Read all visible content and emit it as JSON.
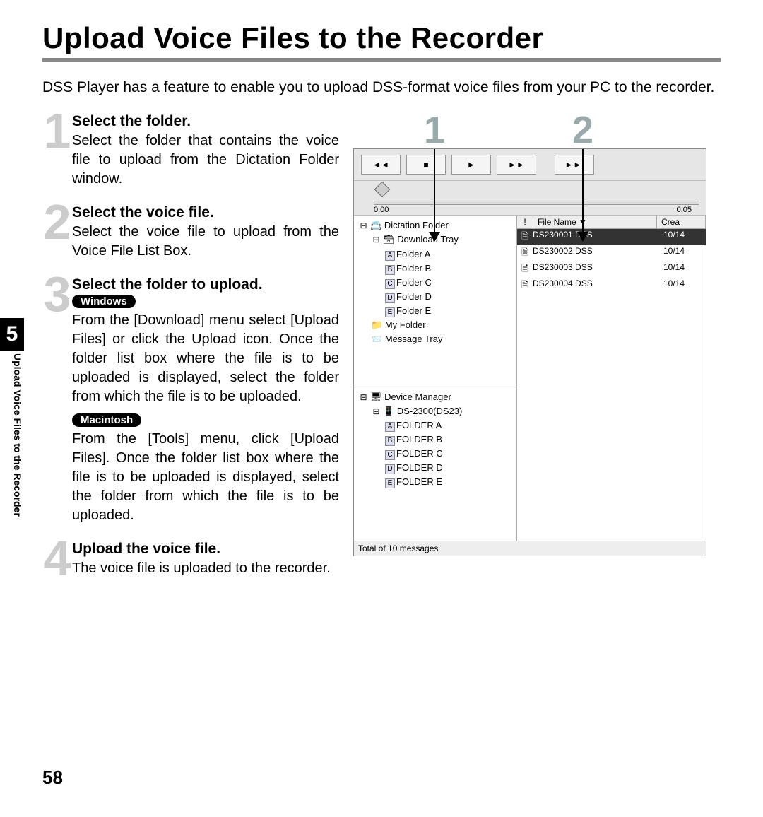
{
  "page": {
    "title": "Upload Voice Files to the Recorder",
    "intro": "DSS Player has a feature to enable you to upload DSS-format voice files from your PC to the recorder.",
    "chapter_number": "5",
    "chapter_title_vert": "Upload Voice Files to the Recorder",
    "page_number": "58"
  },
  "steps": [
    {
      "num": "1",
      "title": "Select the folder.",
      "body": "Select the folder that contains the voice file to upload from the Dictation Folder window."
    },
    {
      "num": "2",
      "title": "Select the voice file.",
      "body": "Select the voice file to upload from the Voice File List Box."
    },
    {
      "num": "3",
      "title": "Select the folder to upload.",
      "pill_win": "Windows",
      "body_win": "From the [Download] menu select [Upload Files] or click the Upload icon. Once the folder list box where the file is to be uploaded is displayed, select the folder from which the file is to be uploaded.",
      "pill_mac": "Macintosh",
      "body_mac": "From the [Tools] menu, click [Upload Files]. Once the folder list box where the file is to be uploaded is displayed, select the folder from which the file is to be uploaded."
    },
    {
      "num": "4",
      "title": "Upload the voice file.",
      "body": "The voice file is uploaded to the recorder."
    }
  ],
  "callouts": {
    "c1": "1",
    "c2": "2"
  },
  "app": {
    "toolbar": {
      "rew": "◄◄",
      "stop": "■",
      "play": "►",
      "ff": "►►",
      "next": "►►I"
    },
    "slider": {
      "tick_left": "0.00",
      "tick_right": "0.05"
    },
    "tree_upper": {
      "root": "Dictation Folder",
      "download": "Download Tray",
      "folders": [
        {
          "letter": "A",
          "name": "Folder A"
        },
        {
          "letter": "B",
          "name": "Folder B"
        },
        {
          "letter": "C",
          "name": "Folder C"
        },
        {
          "letter": "D",
          "name": "Folder D"
        },
        {
          "letter": "E",
          "name": "Folder E"
        }
      ],
      "myfolder": "My Folder",
      "msgtray": "Message Tray"
    },
    "tree_lower": {
      "root": "Device Manager",
      "device": "DS-2300(DS23)",
      "folders": [
        {
          "letter": "A",
          "name": "FOLDER A"
        },
        {
          "letter": "B",
          "name": "FOLDER B"
        },
        {
          "letter": "C",
          "name": "FOLDER C"
        },
        {
          "letter": "D",
          "name": "FOLDER D"
        },
        {
          "letter": "E",
          "name": "FOLDER E"
        }
      ]
    },
    "filehdr": {
      "bang": "!",
      "fname": "File Name",
      "crea": "Crea"
    },
    "files": [
      {
        "name": "DS230001.DSS",
        "crea": "10/14",
        "sel": true
      },
      {
        "name": "DS230002.DSS",
        "crea": "10/14",
        "sel": false
      },
      {
        "name": "DS230003.DSS",
        "crea": "10/14",
        "sel": false
      },
      {
        "name": "DS230004.DSS",
        "crea": "10/14",
        "sel": false
      }
    ],
    "status": "Total of 10 messages"
  }
}
